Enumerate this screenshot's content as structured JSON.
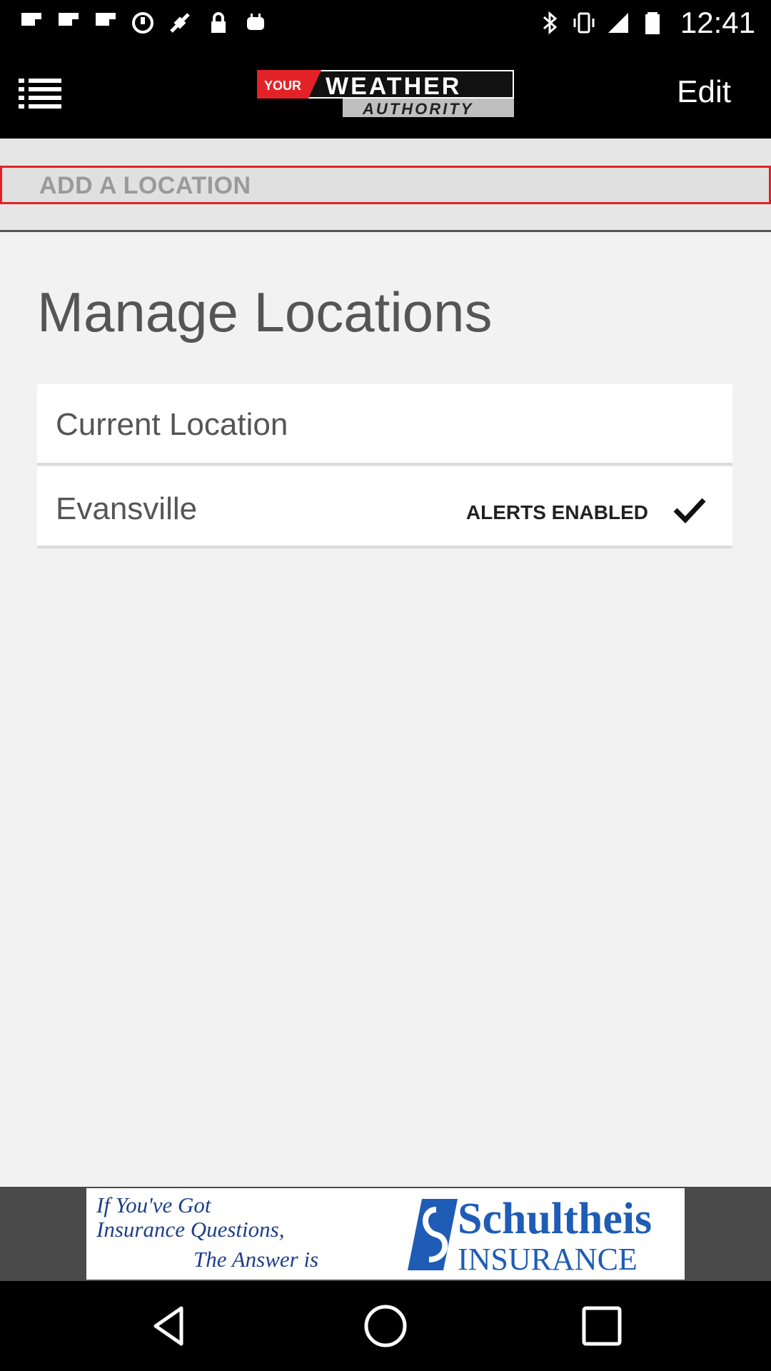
{
  "status_bar": {
    "time": "12:41",
    "icons": [
      "flipboard-icon",
      "flipboard-icon",
      "flipboard-icon",
      "sync-icon",
      "fake-gps-icon",
      "lock-icon",
      "android-icon",
      "bluetooth-icon",
      "vibrate-icon",
      "signal-icon",
      "battery-icon"
    ]
  },
  "app_bar": {
    "logo_your": "YOUR",
    "logo_weather": "WEATHER",
    "logo_authority": "AUTHORITY",
    "edit_label": "Edit",
    "accent": "#e32228"
  },
  "add_location": {
    "label": "ADD A LOCATION"
  },
  "page": {
    "title": "Manage Locations"
  },
  "locations": [
    {
      "name": "Current Location",
      "alerts": ""
    },
    {
      "name": "Evansville",
      "alerts": "ALERTS ENABLED"
    }
  ],
  "ad": {
    "line1": "If You've Got",
    "line2": "Insurance Questions,",
    "line3": "The Answer is",
    "brand": "Schultheis",
    "brand_sub": "INSURANCE"
  }
}
